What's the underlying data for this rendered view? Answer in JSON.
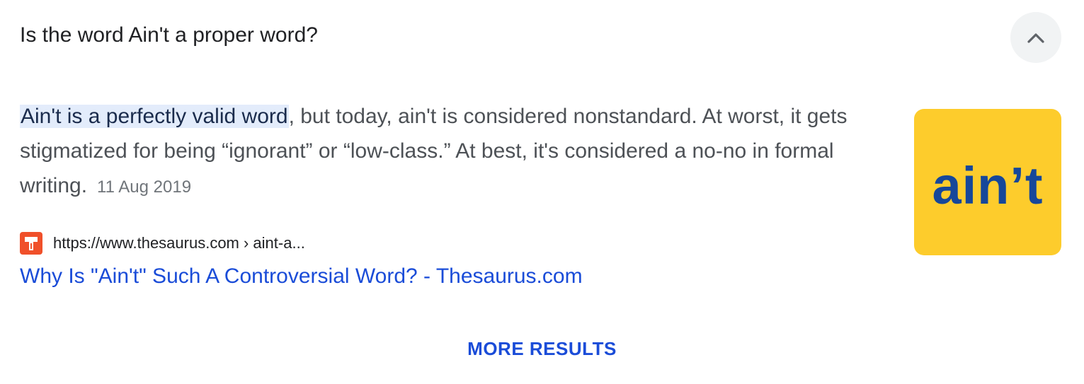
{
  "question": {
    "text": "Is the word Ain't a proper word?",
    "collapse_icon": "chevron-up-icon"
  },
  "answer": {
    "highlighted": "Ain't is a perfectly valid word",
    "rest": ", but today, ain't is considered nonstandard. At worst, it gets stigmatized for being “ignorant” or “low-class.” At best, it's considered a no-no in formal writing.",
    "date": "11 Aug 2019"
  },
  "source": {
    "favicon_icon": "thesaurus-favicon-icon",
    "url": "https://www.thesaurus.com › aint-a...",
    "title": "Why Is \"Ain't\" Such A Controversial Word? - Thesaurus.com"
  },
  "thumbnail": {
    "text": "ain’t",
    "background": "#fdcc2c",
    "text_color": "#16479a"
  },
  "more_results": {
    "label": "MORE RESULTS"
  },
  "colors": {
    "link": "#1a4cd8",
    "highlight": "#e3ecfb",
    "favicon": "#f0502a"
  }
}
